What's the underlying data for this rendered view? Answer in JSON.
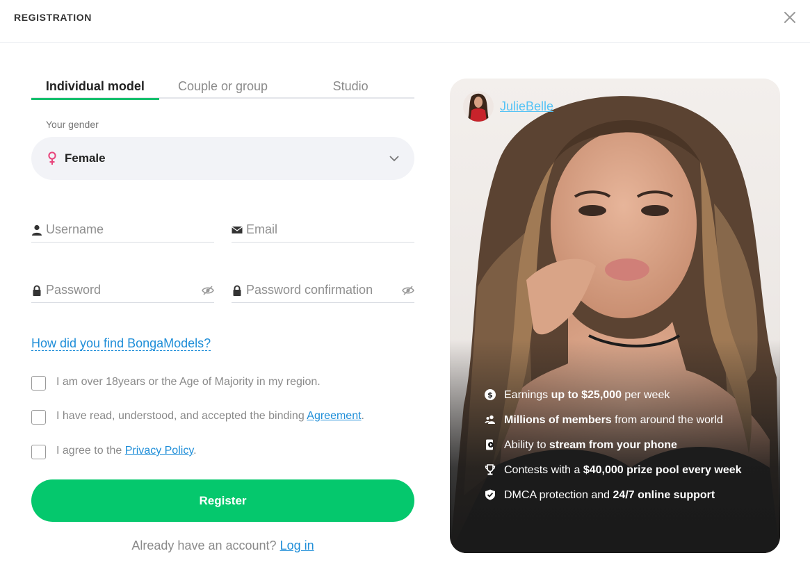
{
  "header": {
    "title": "REGISTRATION"
  },
  "tabs": [
    {
      "label": "Individual model",
      "active": true
    },
    {
      "label": "Couple or group",
      "active": false
    },
    {
      "label": "Studio",
      "active": false
    }
  ],
  "gender": {
    "label": "Your gender",
    "value": "Female",
    "icon": "female-icon",
    "accent": "#e8457c"
  },
  "fields": {
    "username": {
      "placeholder": "Username",
      "value": "",
      "icon": "user-icon"
    },
    "email": {
      "placeholder": "Email",
      "value": "",
      "icon": "envelope-icon"
    },
    "password": {
      "placeholder": "Password",
      "value": "",
      "icon": "lock-icon"
    },
    "password_confirmation": {
      "placeholder": "Password confirmation",
      "value": "",
      "icon": "lock-icon"
    }
  },
  "find_link": "How did you find BongaModels?",
  "checks": {
    "age": {
      "text": "I am over 18years or the Age of Majority in my region.",
      "checked": false
    },
    "agreement": {
      "text_before": "I have read, understood, and accepted the binding ",
      "link": "Agreement",
      "text_after": ".",
      "checked": false
    },
    "privacy": {
      "text_before": "I agree to the ",
      "link": "Privacy Policy",
      "text_after": ".",
      "checked": false
    }
  },
  "register": {
    "label": "Register",
    "color": "#05c86d"
  },
  "login": {
    "prompt": "Already have an account?",
    "link": "Log in"
  },
  "promo": {
    "model_name": "JulieBelle",
    "benefits": [
      {
        "icon": "dollar-icon",
        "pre": "Earnings ",
        "bold": "up to $25,000",
        "post": " per week"
      },
      {
        "icon": "users-icon",
        "pre": "",
        "bold": "Millions of members",
        "post": " from around the world"
      },
      {
        "icon": "phone-stream-icon",
        "pre": "Ability to ",
        "bold": "stream from your phone",
        "post": ""
      },
      {
        "icon": "trophy-icon",
        "pre": "Contests with a ",
        "bold": "$40,000 prize pool every week",
        "post": ""
      },
      {
        "icon": "shield-icon",
        "pre": "DMCA protection and ",
        "bold": "24/7 online support",
        "post": ""
      }
    ]
  },
  "colors": {
    "accent": "#17c06e",
    "link": "#1f8ed8",
    "model_link": "#56c3f5"
  }
}
